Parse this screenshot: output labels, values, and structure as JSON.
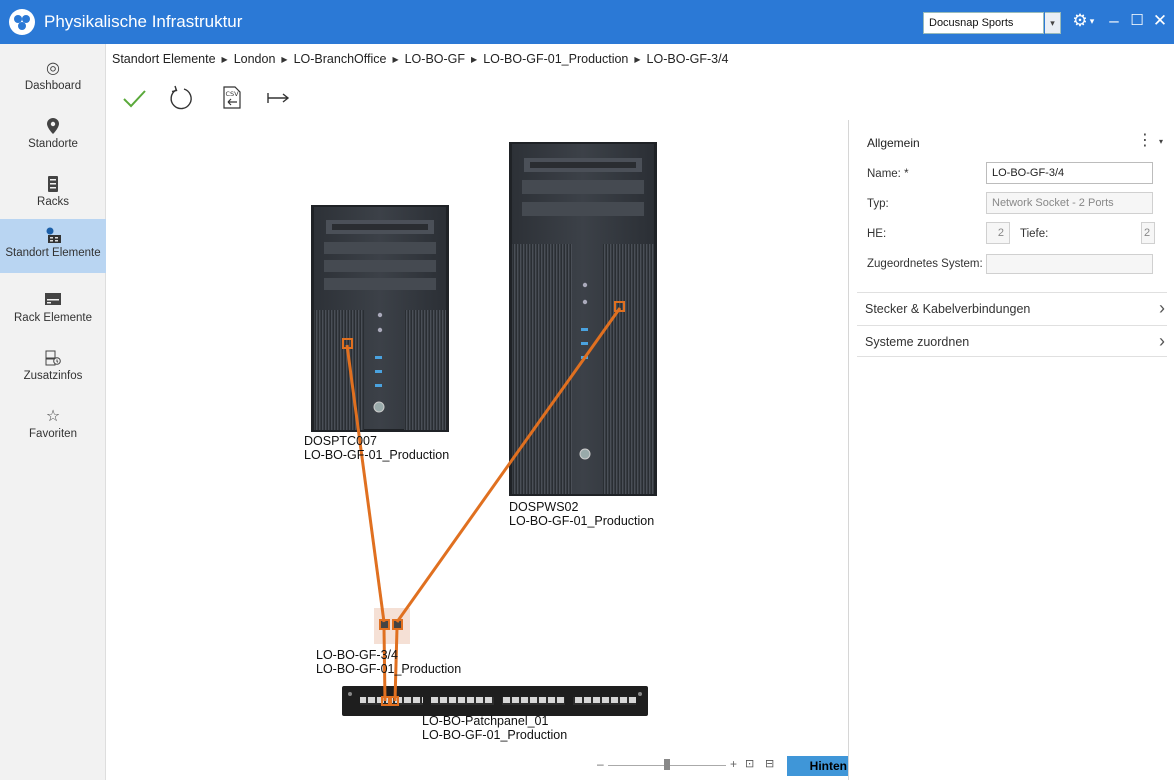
{
  "app": {
    "title": "Physikalische Infrastruktur",
    "tenant": "Docusnap Sports"
  },
  "titlebar_icons": [
    "settings-icon",
    "minimize-icon",
    "maximize-icon",
    "close-icon"
  ],
  "sidebar": {
    "items": [
      {
        "label": "Dashboard",
        "icon": "gauge-icon"
      },
      {
        "label": "Standorte",
        "icon": "location-pin-icon"
      },
      {
        "label": "Racks",
        "icon": "rack-icon"
      },
      {
        "label": "Standort Elemente",
        "icon": "site-elements-icon",
        "active": true
      },
      {
        "label": "Rack Elemente",
        "icon": "rack-element-icon"
      },
      {
        "label": "Zusatzinfos",
        "icon": "info-documents-icon"
      },
      {
        "label": "Favoriten",
        "icon": "star-icon"
      }
    ]
  },
  "breadcrumb": [
    "Standort Elemente",
    "London",
    "LO-BranchOffice",
    "LO-BO-GF",
    "LO-BO-GF-01_Production",
    "LO-BO-GF-3/4"
  ],
  "toolbar": [
    "check-icon",
    "refresh-icon",
    "csv-export-icon",
    "forward-arrow-icon"
  ],
  "canvas": {
    "devices": [
      {
        "name": "DOSPTC007",
        "location": "LO-BO-GF-01_Production"
      },
      {
        "name": "DOSPWS02",
        "location": "LO-BO-GF-01_Production"
      },
      {
        "name": "LO-BO-GF-3/4",
        "location": "LO-BO-GF-01_Production"
      },
      {
        "name": "LO-BO-Patchpanel_01",
        "location": "LO-BO-GF-01_Production"
      }
    ]
  },
  "zoom": {
    "minus": "–",
    "plus": "+",
    "view": "Hinten",
    "accent": "#3f96d8"
  },
  "panel": {
    "header": "Allgemein",
    "fields": {
      "name_label": "Name: *",
      "name_value": "LO-BO-GF-3/4",
      "type_label": "Typ:",
      "type_value": "Network Socket - 2 Ports",
      "he_label": "HE:",
      "he_value": "2",
      "depth_label": "Tiefe:",
      "depth_value": "2",
      "system_label": "Zugeordnetes System:",
      "system_value": ""
    },
    "sections": [
      "Stecker & Kabelverbindungen",
      "Systeme zuordnen"
    ]
  },
  "colors": {
    "titlebar": "#2b79d6",
    "cable": "#e07020",
    "sidebar_active": "#b9d5f2"
  }
}
